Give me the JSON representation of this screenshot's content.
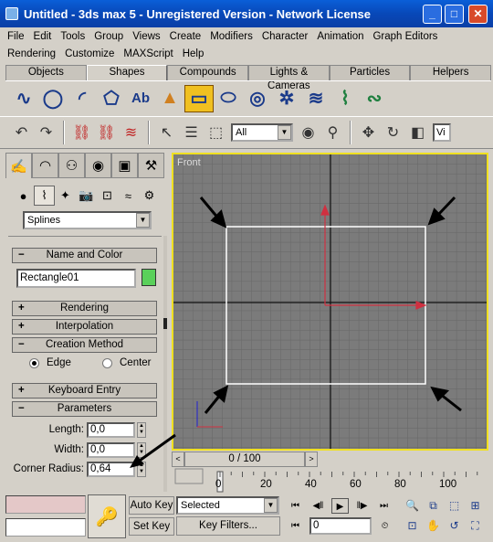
{
  "window": {
    "title": "Untitled  - 3ds max 5 - Unregistered Version - Network License"
  },
  "menu_row1": [
    "File",
    "Edit",
    "Tools",
    "Group",
    "Views",
    "Create",
    "Modifiers",
    "Character",
    "Animation",
    "Graph Editors"
  ],
  "menu_row2": [
    "Rendering",
    "Customize",
    "MAXScript",
    "Help"
  ],
  "tabs": [
    "Objects",
    "Shapes",
    "Compounds",
    "Lights & Cameras",
    "Particles",
    "Helpers"
  ],
  "active_tab": "Shapes",
  "selection_filter": "All",
  "view_field": "Vi",
  "command_panel": {
    "category_dropdown": "Splines",
    "rollouts": {
      "name_and_color": "Name and Color",
      "rendering": "Rendering",
      "interpolation": "Interpolation",
      "creation_method": "Creation Method",
      "keyboard_entry": "Keyboard Entry",
      "parameters": "Parameters"
    },
    "object_name": "Rectangle01",
    "object_color": "#5ad05a",
    "creation_method": {
      "edge": "Edge",
      "center": "Center",
      "selected": "Edge"
    },
    "params": {
      "length_label": "Length:",
      "length": "0,0",
      "width_label": "Width:",
      "width": "0,0",
      "corner_label": "Corner Radius:",
      "corner": "0,64"
    },
    "signs": {
      "open": "−",
      "closed": "+"
    }
  },
  "viewport": {
    "label": "Front"
  },
  "timeline": {
    "slider": "0 / 100",
    "ticks": [
      "0",
      "20",
      "40",
      "60",
      "80",
      "100"
    ]
  },
  "bottom": {
    "auto_key": "Auto Key",
    "set_key": "Set Key",
    "selected": "Selected",
    "key_filters": "Key Filters...",
    "frame": "0"
  }
}
